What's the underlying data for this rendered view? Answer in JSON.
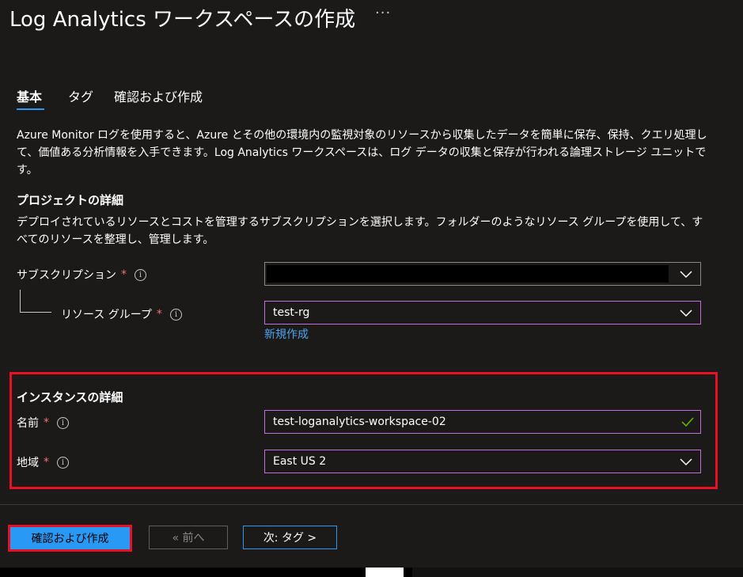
{
  "header": {
    "title": "Log Analytics ワークスペースの作成",
    "more_label": "···"
  },
  "tabs": [
    {
      "label": "基本",
      "active": true
    },
    {
      "label": "タグ",
      "active": false
    },
    {
      "label": "確認および作成",
      "active": false
    }
  ],
  "intro": {
    "text": "Azure Monitor ログを使用すると、Azure とその他の環境内の監視対象のリソースから収集したデータを簡単に保存、保持、クエリ処理して、価値ある分析情報を入手できます。Log Analytics ワークスペースは、ログ データの収集と保存が行われる論理ストレージ ユニットです。"
  },
  "project": {
    "title": "プロジェクトの詳細",
    "description": "デプロイされているリソースとコストを管理するサブスクリプションを選択します。フォルダーのようなリソース グループを使用して、すべてのリソースを整理し、管理します。",
    "subscription": {
      "label": "サブスクリプション",
      "required": "*",
      "value": ""
    },
    "resource_group": {
      "label": "リソース グループ",
      "required": "*",
      "value": "test-rg"
    },
    "new_link": "新規作成"
  },
  "instance": {
    "title": "インスタンスの詳細",
    "name": {
      "label": "名前",
      "required": "*",
      "value": "test-loganalytics-workspace-02"
    },
    "region": {
      "label": "地域",
      "required": "*",
      "value": "East US 2"
    }
  },
  "footer": {
    "review_create": "確認および作成",
    "previous": "« 前へ",
    "next": "次: タグ >"
  },
  "icons": {
    "info": "info-icon",
    "chevron": "chevron-down-icon",
    "check": "check-icon"
  },
  "colors": {
    "background": "#1b1a19",
    "accent": "#2899f5",
    "required": "#f1707b",
    "focus_border": "#c36ede",
    "highlight": "#e81123",
    "success": "#6bb700"
  }
}
